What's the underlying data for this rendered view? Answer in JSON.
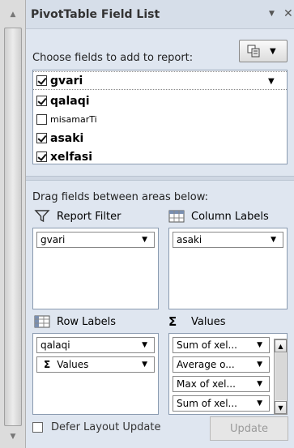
{
  "panel": {
    "title": "PivotTable Field List",
    "choose_label": "Choose fields to add to report:",
    "drag_label": "Drag fields between areas below:"
  },
  "fields": [
    {
      "name": "gvari",
      "checked": true
    },
    {
      "name": "qalaqi",
      "checked": true
    },
    {
      "name": "misamarTi",
      "checked": false
    },
    {
      "name": "asaki",
      "checked": true
    },
    {
      "name": "xelfasi",
      "checked": true
    }
  ],
  "areas": {
    "report_filter": {
      "label": "Report Filter",
      "items": [
        "gvari"
      ]
    },
    "column_labels": {
      "label": "Column Labels",
      "items": [
        "asaki"
      ]
    },
    "row_labels": {
      "label": "Row Labels",
      "items": [
        "qalaqi",
        "Values"
      ]
    },
    "values": {
      "label": "Values",
      "items": [
        "Sum of xel...",
        "Average o...",
        "Max of xel...",
        "Sum of xel..."
      ]
    }
  },
  "footer": {
    "defer_label": "Defer Layout Update",
    "update_label": "Update"
  },
  "icons": {
    "values_symbol": "Σ"
  },
  "colors": {
    "pane_bg": "#dfe6f0",
    "disabled_text": "#9a9a9a"
  }
}
